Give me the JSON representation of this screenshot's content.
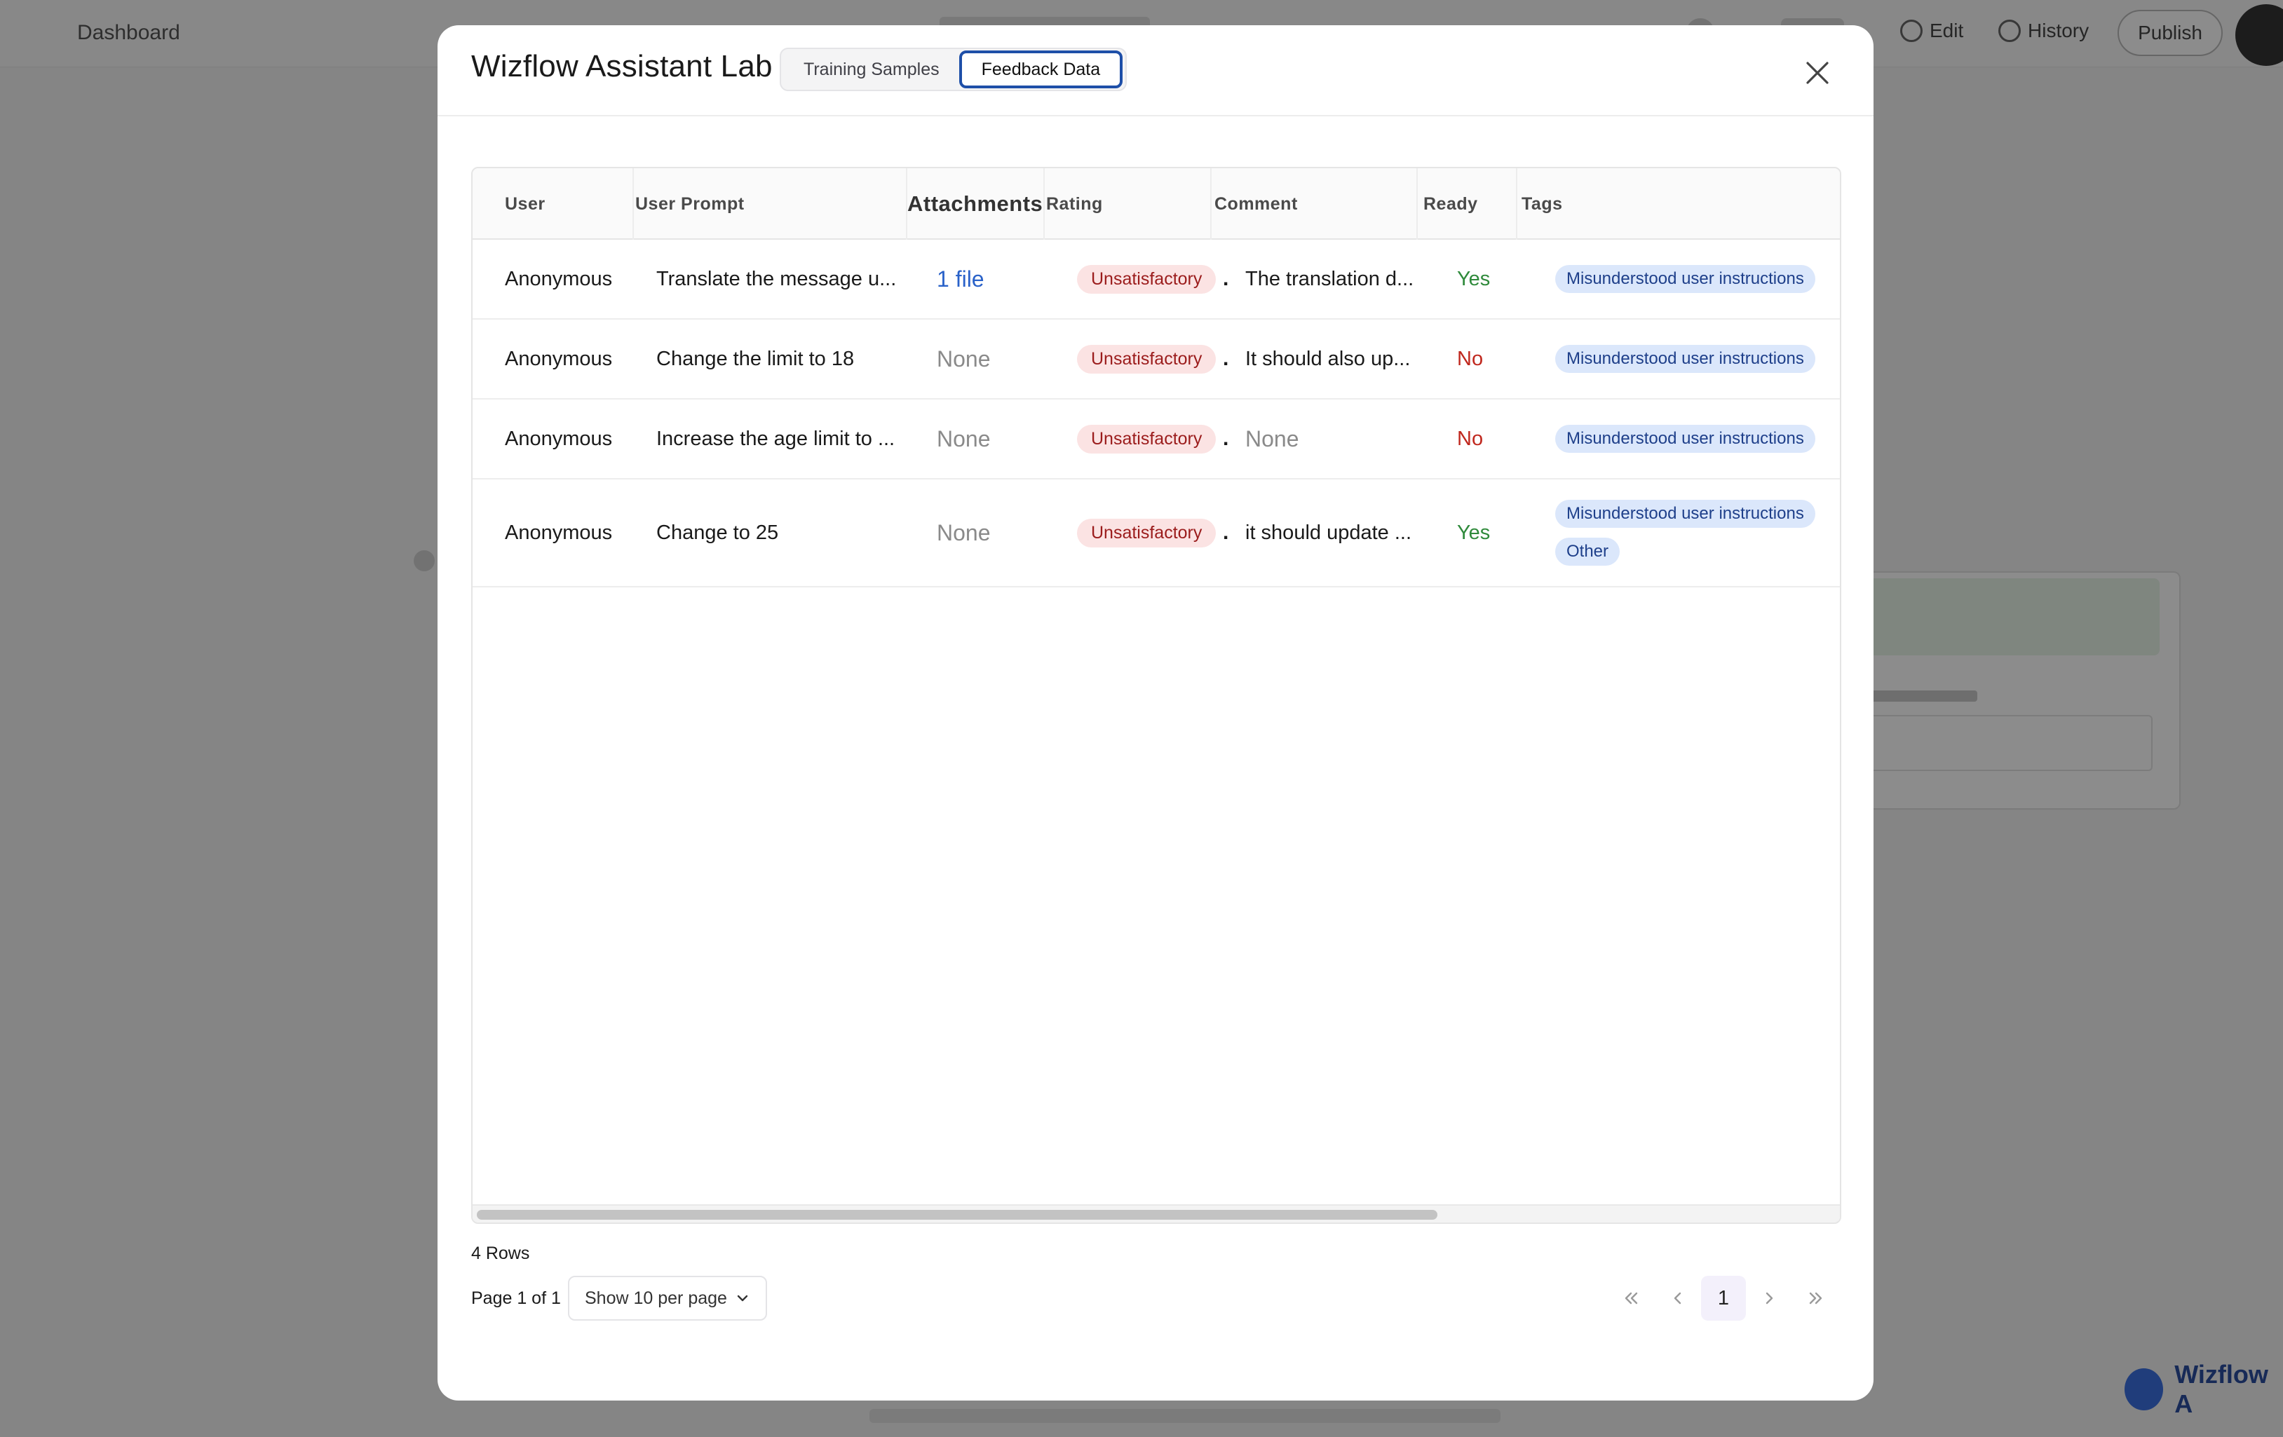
{
  "background": {
    "topbar_left": "Dashboard",
    "edit_label": "Edit",
    "history_label": "History",
    "publish_label": "Publish",
    "chat_label": "Wizflow A"
  },
  "modal": {
    "title": "Wizflow Assistant Lab",
    "tabs": [
      {
        "label": "Training Samples",
        "active": false
      },
      {
        "label": "Feedback Data",
        "active": true
      }
    ],
    "close_icon": "close-icon"
  },
  "table": {
    "columns": [
      "User",
      "User Prompt",
      "Attachments",
      "Rating",
      "Comment",
      "Ready",
      "Tags"
    ],
    "rows": [
      {
        "user": "Anonymous",
        "prompt": "Translate the message u...",
        "attachments": "1 file",
        "rating": "Unsatisfactory",
        "sep": ".",
        "comment": "The translation d...",
        "ready": "Yes",
        "tags": [
          "Misunderstood user instructions"
        ]
      },
      {
        "user": "Anonymous",
        "prompt": "Change the limit to 18",
        "attachments": "None",
        "rating": "Unsatisfactory",
        "sep": ".",
        "comment": "It should also up...",
        "ready": "No",
        "tags": [
          "Misunderstood user instructions"
        ]
      },
      {
        "user": "Anonymous",
        "prompt": "Increase the age limit to ...",
        "attachments": "None",
        "rating": "Unsatisfactory",
        "sep": ".",
        "comment": "None",
        "ready": "No",
        "tags": [
          "Misunderstood user instructions"
        ]
      },
      {
        "user": "Anonymous",
        "prompt": "Change to 25",
        "attachments": "None",
        "rating": "Unsatisfactory",
        "sep": ".",
        "comment": "it should update ...",
        "ready": "Yes",
        "tags": [
          "Misunderstood user instructions",
          "Other"
        ]
      }
    ]
  },
  "footer": {
    "rows_count": "4 Rows",
    "page_label": "Page 1 of 1",
    "per_page": "Show 10 per page",
    "current_page": "1"
  },
  "colors": {
    "accent": "#1e4fa8",
    "yes": "#2f8a3b",
    "no": "#c0281e",
    "rating_pill_bg": "#fbe3e3",
    "tag_pill_bg": "#dbe7fb"
  }
}
